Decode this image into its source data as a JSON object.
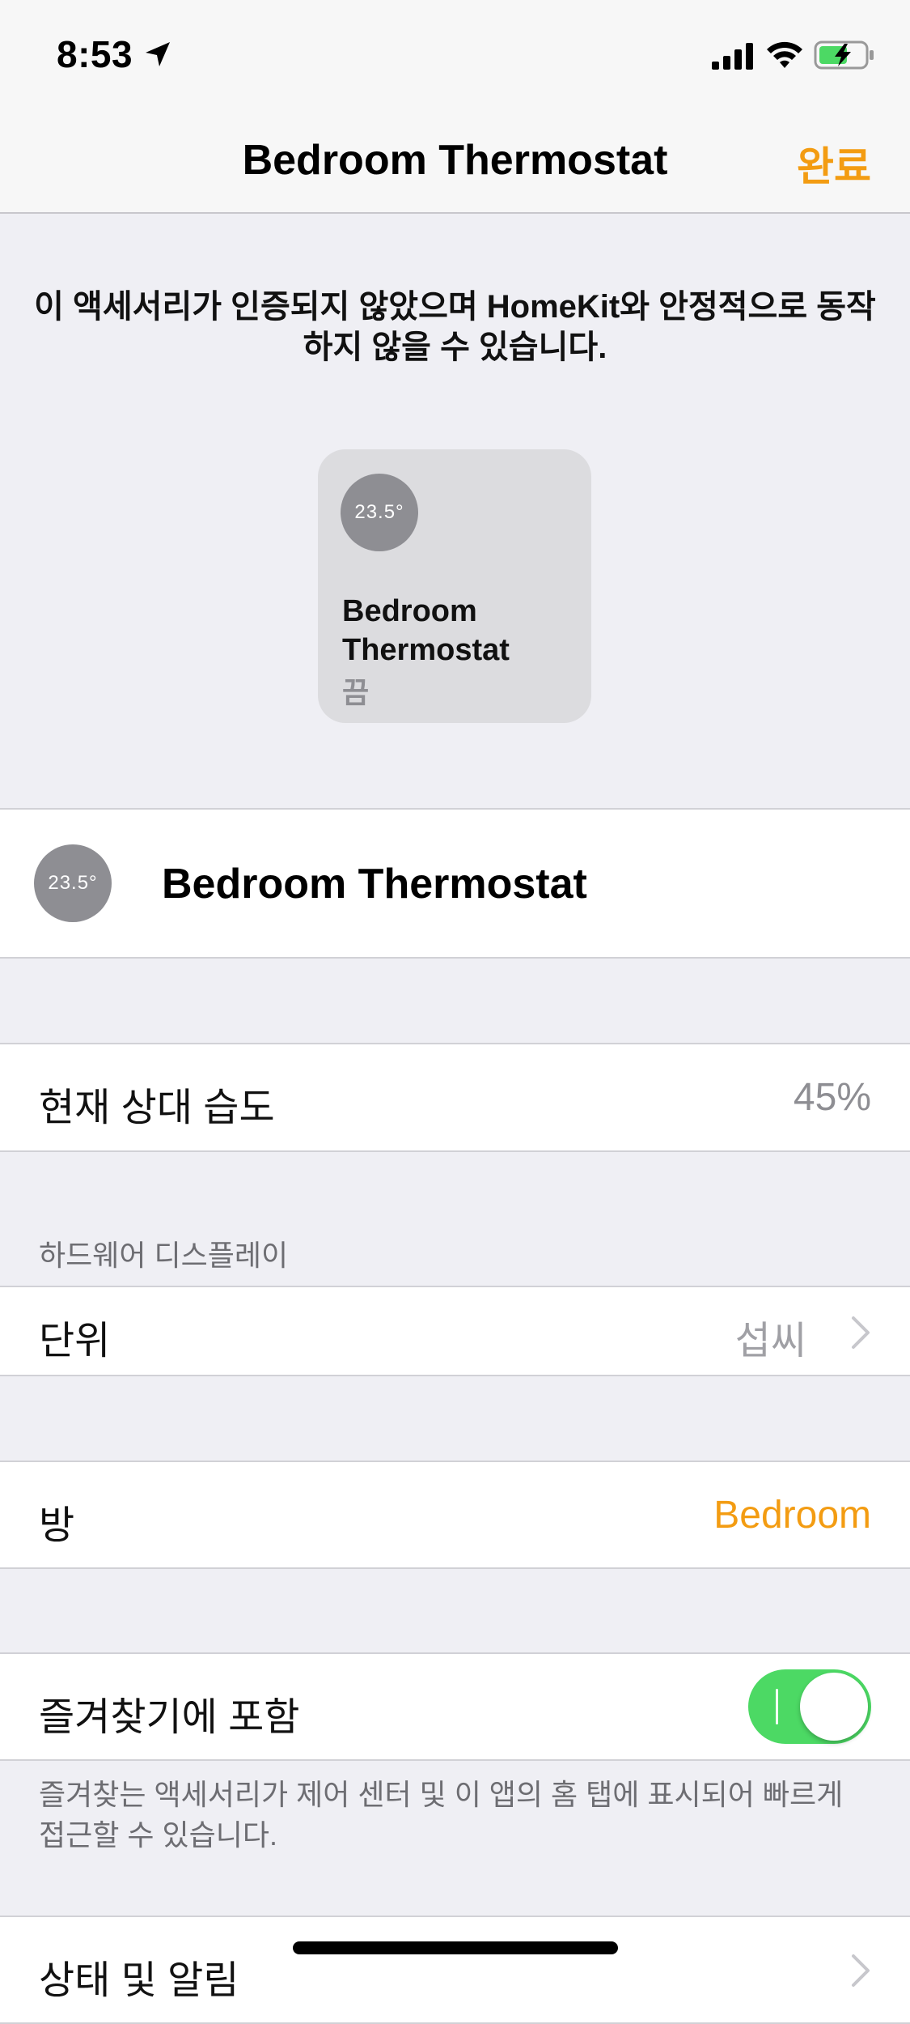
{
  "status_bar": {
    "time": "8:53"
  },
  "nav": {
    "title": "Bedroom Thermostat",
    "done_label": "완료"
  },
  "warning_text": "이 액세서리가 인증되지 않았으며 HomeKit와 안정적으로 동작하지 않을 수 있습니다.",
  "tile": {
    "temperature": "23.5°",
    "name": "Bedroom Thermostat",
    "status": "끔"
  },
  "accessory": {
    "temperature": "23.5°",
    "name": "Bedroom Thermostat"
  },
  "humidity": {
    "label": "현재 상대 습도",
    "value": "45%"
  },
  "hardware_display": {
    "section_header": "하드웨어 디스플레이",
    "unit_label": "단위",
    "unit_value": "섭씨"
  },
  "room": {
    "label": "방",
    "value": "Bedroom"
  },
  "favorites": {
    "label": "즐겨찾기에 포함",
    "enabled": true,
    "note": "즐겨찾는 액세서리가 제어 센터 및 이 앱의 홈 탭에 표시되어 빠르게 접근할 수 있습니다."
  },
  "status_notifications": {
    "label": "상태 및 알림"
  },
  "colors": {
    "accent": "#f39c12",
    "toggle_on": "#4cd964",
    "background": "#efeff4"
  }
}
